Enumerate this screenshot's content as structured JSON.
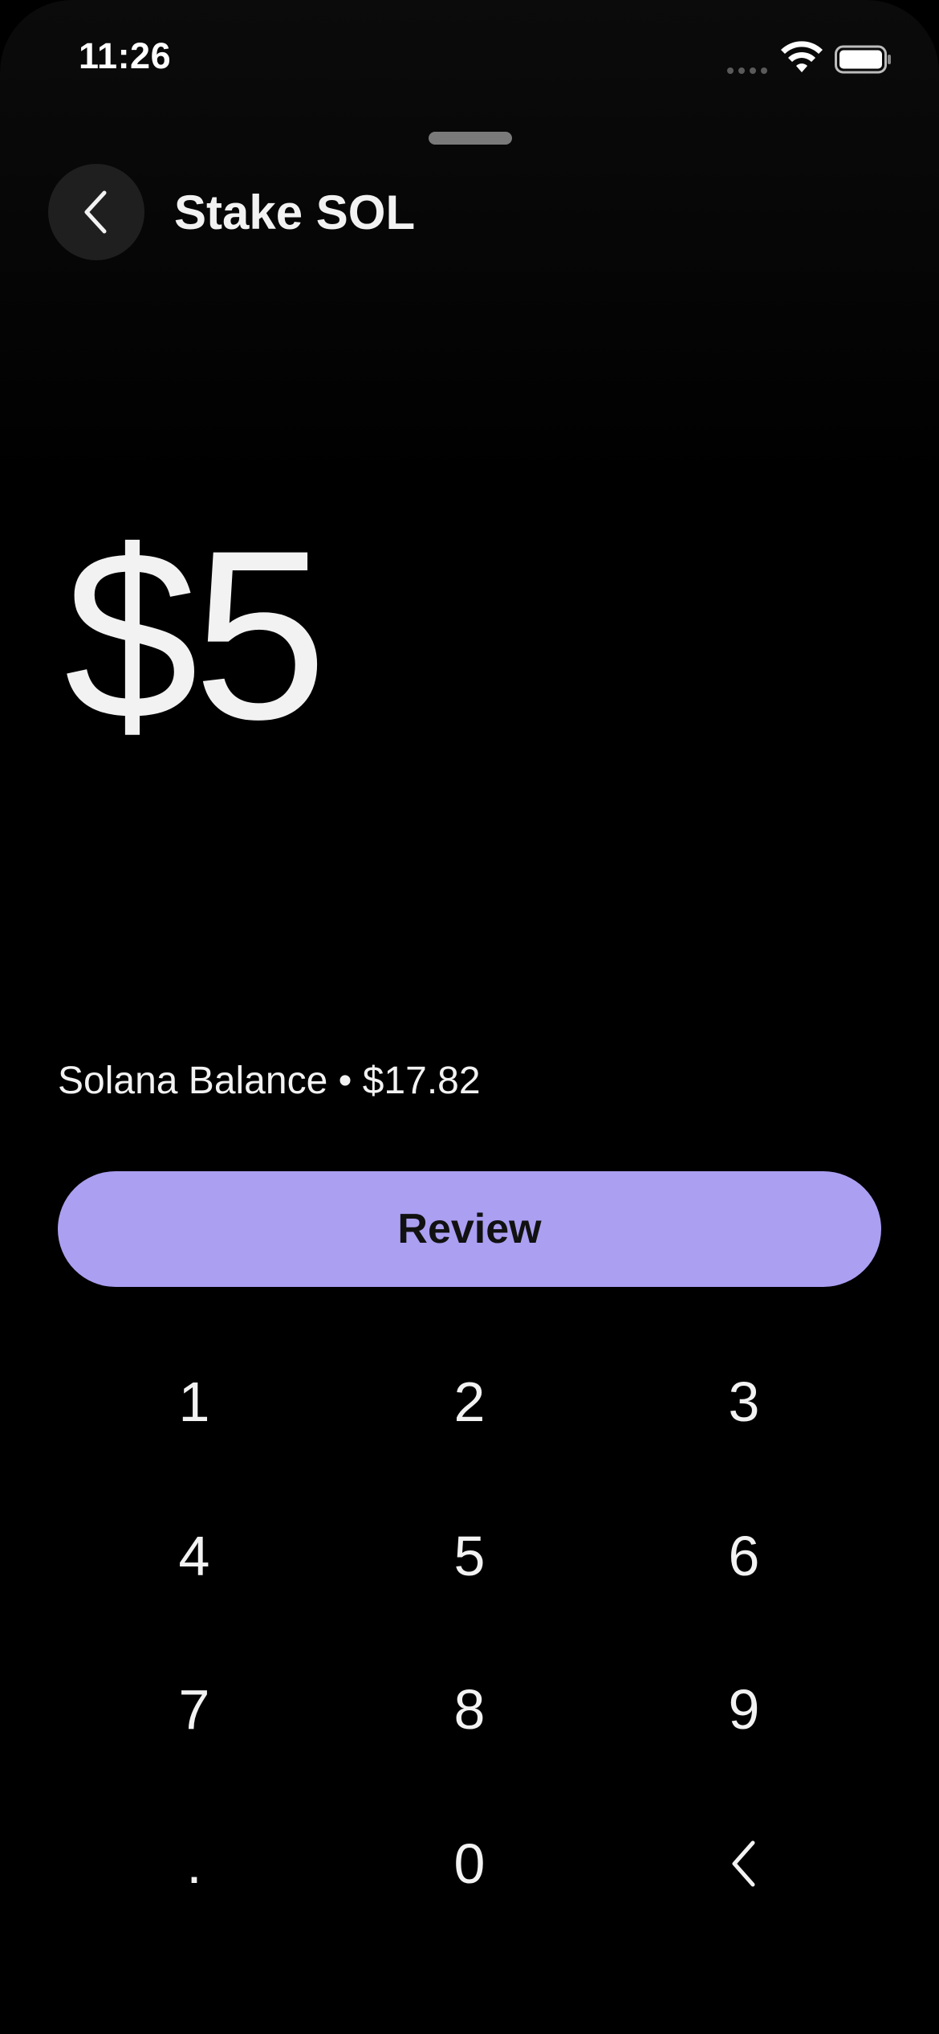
{
  "status_bar": {
    "time": "11:26",
    "wifi_icon": "wifi-icon",
    "battery_icon": "battery-icon"
  },
  "header": {
    "title": "Stake SOL",
    "back_icon": "chevron-left-icon"
  },
  "amount": {
    "value": "$5"
  },
  "balance": {
    "text": "Solana Balance • $17.82"
  },
  "review_button": {
    "label": "Review"
  },
  "keypad": {
    "keys": [
      "1",
      "2",
      "3",
      "4",
      "5",
      "6",
      "7",
      "8",
      "9",
      ".",
      "0"
    ],
    "backspace_icon": "backspace-chevron-icon"
  },
  "colors": {
    "background": "#000000",
    "accent": "#ab9ff2",
    "text": "#f2f2f2"
  }
}
